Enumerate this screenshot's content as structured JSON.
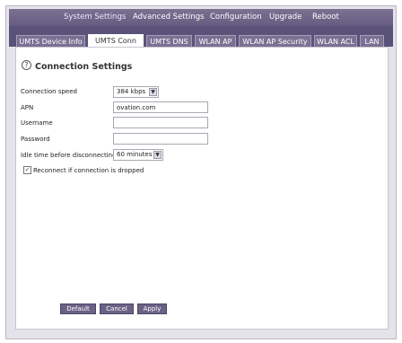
{
  "topnav": {
    "items": [
      {
        "label": "System Settings"
      },
      {
        "label": "Advanced Settings"
      },
      {
        "label": "Configuration"
      },
      {
        "label": "Upgrade"
      },
      {
        "label": "Reboot"
      }
    ],
    "active_index": 0
  },
  "tabs": {
    "items": [
      {
        "label": "UMTS Device Info"
      },
      {
        "label": "UMTS Conn"
      },
      {
        "label": "UMTS DNS"
      },
      {
        "label": "WLAN AP"
      },
      {
        "label": "WLAN AP Security"
      },
      {
        "label": "WLAN ACL"
      },
      {
        "label": "LAN"
      }
    ],
    "active_index": 1
  },
  "panel": {
    "title": "Connection Settings",
    "help_glyph": "?"
  },
  "form": {
    "connection_speed": {
      "label": "Connection speed",
      "value": "384 kbps"
    },
    "apn": {
      "label": "APN",
      "value": "ovation.com"
    },
    "username": {
      "label": "Username",
      "value": ""
    },
    "password": {
      "label": "Password",
      "value": ""
    },
    "idle_time": {
      "label": "Idle time before disconnecting",
      "value": "60 minutes"
    },
    "reconnect": {
      "label": "Reconnect if connection is dropped",
      "checked": true,
      "check_glyph": "✓"
    }
  },
  "buttons": {
    "default_label": "Default",
    "cancel_label": "Cancel",
    "apply_label": "Apply"
  },
  "icons": {
    "dropdown_arrow": "▼"
  },
  "colors": {
    "nav_bg": "#6d6489",
    "tab_bar_bg": "#5b527a",
    "active_tab_bg": "#ffffff",
    "button_bg": "#6a6285"
  }
}
